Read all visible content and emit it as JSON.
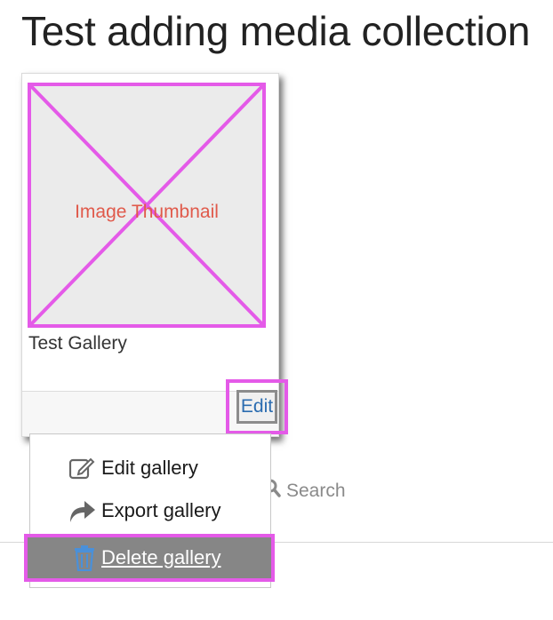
{
  "page": {
    "title": "Test adding media collection"
  },
  "gallery_card": {
    "thumbnail_label": "Image Thumbnail",
    "title": "Test Gallery",
    "edit_label": "Edit"
  },
  "dropdown": {
    "items": [
      {
        "label": "Edit gallery",
        "icon": "edit-icon"
      },
      {
        "label": "Export gallery",
        "icon": "share-arrow-icon"
      },
      {
        "label": "Delete gallery",
        "icon": "trash-icon"
      }
    ]
  },
  "search": {
    "label": "Search",
    "icon": "search-icon"
  },
  "colors": {
    "highlight": "#e45ae8",
    "link": "#2b6cb0",
    "thumbnail_label": "#e05a4b",
    "delete_bg": "#868686"
  }
}
